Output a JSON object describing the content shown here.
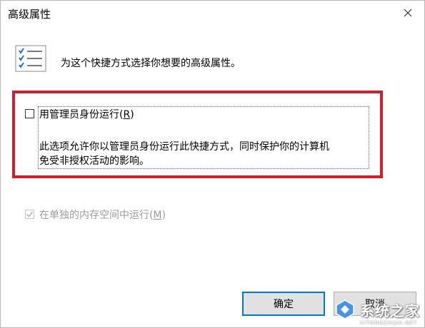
{
  "window": {
    "title": "高级属性",
    "close_icon": "close-icon"
  },
  "header": {
    "icon": "properties-list-icon",
    "text": "为这个快捷方式选择你想要的高级属性。"
  },
  "options": {
    "run_as_admin": {
      "label": "用管理员身份运行",
      "mnemonic": "R",
      "checked": false,
      "description_line1": "此选项允许你以管理员身份运行此快捷方式，同时保护你的计算机",
      "description_line2": "免受非授权活动的影响。"
    },
    "separate_memory": {
      "label": "在单独的内存空间中运行",
      "mnemonic": "M",
      "checked": true,
      "disabled": true
    }
  },
  "buttons": {
    "ok_label": "确定",
    "cancel_label": "取消"
  },
  "watermark": {
    "text": "系统之家",
    "subtext": "XITONGZHIJIA.NET"
  },
  "colors": {
    "highlight_frame": "#d41c2c",
    "ok_button_border": "#0078d7",
    "disabled_text": "#9b9b9b"
  }
}
